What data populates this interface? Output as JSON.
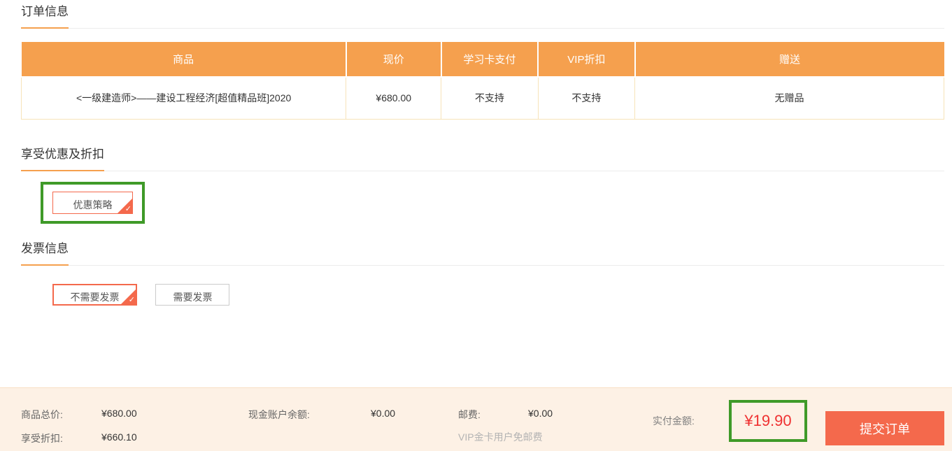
{
  "colors": {
    "accent_orange": "#F5A04E",
    "tomato": "#F4694C",
    "price_red": "#EF3131",
    "annotation_green": "#3F9A28",
    "table_border_cream": "#F7E3B9",
    "bar_background": "#FDF1E5"
  },
  "order_info": {
    "title": "订单信息"
  },
  "order_table": {
    "headers": [
      "商品",
      "现价",
      "学习卡支付",
      "VIP折扣",
      "赠送"
    ],
    "row": {
      "product": "<一级建造师>——建设工程经济[超值精品班]2020",
      "price": "¥680.00",
      "card_pay": "不支持",
      "vip_discount": "不支持",
      "gift": "无赠品"
    }
  },
  "discount_section": {
    "title": "享受优惠及折扣",
    "strategy_button": "优惠策略"
  },
  "invoice_section": {
    "title": "发票信息",
    "no_invoice_button": "不需要发票",
    "need_invoice_button": "需要发票"
  },
  "icons": {
    "check": "✓"
  },
  "summary_bar": {
    "total_label": "商品总价:",
    "total_value": "¥680.00",
    "discount_label": "享受折扣:",
    "discount_value": "¥660.10",
    "cash_label": "现金账户余额:",
    "cash_value": "¥0.00",
    "postage_label": "邮费:",
    "postage_value": "¥0.00",
    "postage_note": "VIP金卡用户免邮费",
    "payable_label": "实付金额:",
    "payable_value": "¥19.90",
    "submit_button": "提交订单"
  }
}
